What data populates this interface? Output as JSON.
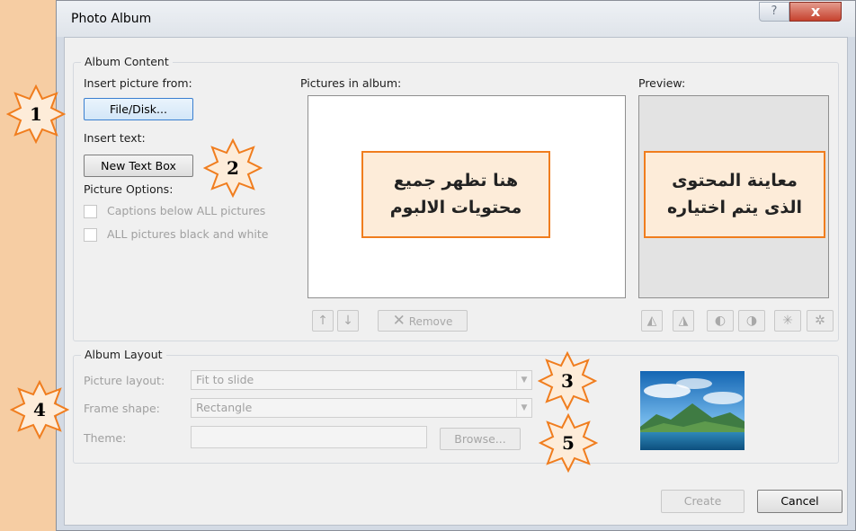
{
  "dialog": {
    "title": "Photo Album",
    "help_glyph": "?",
    "close_glyph": "x"
  },
  "album_content": {
    "legend": "Album Content",
    "insert_picture_label": "Insert picture from:",
    "file_disk_button": "File/Disk...",
    "insert_text_label": "Insert text:",
    "new_text_box_button": "New Text Box",
    "picture_options_label": "Picture Options:",
    "captions_checkbox": "Captions below ALL pictures",
    "black_white_checkbox": "ALL pictures black and white",
    "pictures_in_album_label": "Pictures in album:",
    "preview_label": "Preview:",
    "remove_button": "Remove"
  },
  "album_layout": {
    "legend": "Album Layout",
    "picture_layout_label": "Picture layout:",
    "picture_layout_value": "Fit to slide",
    "frame_shape_label": "Frame shape:",
    "frame_shape_value": "Rectangle",
    "theme_label": "Theme:",
    "theme_value": "",
    "browse_button": "Browse..."
  },
  "footer": {
    "create_button": "Create",
    "cancel_button": "Cancel"
  },
  "annotations": {
    "album_box_line1": "هنا تظهر جميع",
    "album_box_line2": "محتويات الالبوم",
    "preview_box_line1": "معاينة المحتوى",
    "preview_box_line2": "الذى يتم اختياره",
    "badges": [
      "1",
      "2",
      "3",
      "4",
      "5"
    ]
  },
  "icons": {
    "move_up": "up-arrow-icon",
    "move_down": "down-arrow-icon",
    "remove": "x-icon",
    "rotate_left": "rotate-left-icon",
    "rotate_right": "rotate-right-icon",
    "contrast_up": "contrast-increase-icon",
    "contrast_down": "contrast-decrease-icon",
    "brightness_up": "brightness-increase-icon",
    "brightness_down": "brightness-decrease-icon"
  },
  "colors": {
    "background": "#f6cda3",
    "callout_border": "#f07d1e",
    "star_fill": "#fdecd9",
    "close_button": "#c6422e"
  }
}
